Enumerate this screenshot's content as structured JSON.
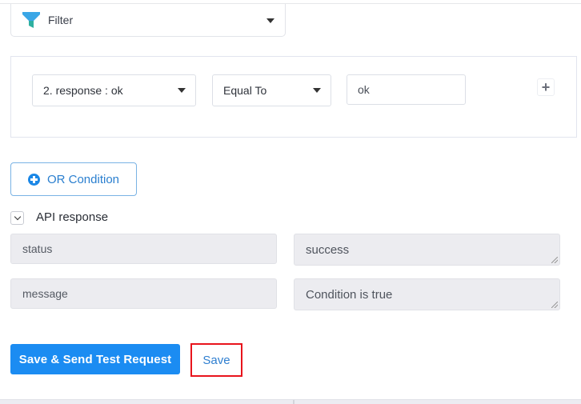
{
  "filter": {
    "label": "Filter",
    "icon": "filter-funnel-icon"
  },
  "condition": {
    "field_value": "2. response : ok",
    "operator_value": "Equal To",
    "compare_value": "ok",
    "add_label": "+"
  },
  "or_condition": {
    "label": "OR Condition",
    "icon": "plus-circle-icon"
  },
  "api_response": {
    "title": "API response",
    "toggle_icon": "chevron-down-icon",
    "rows": [
      {
        "key": "status",
        "value": "success"
      },
      {
        "key": "message",
        "value": "Condition is true"
      }
    ]
  },
  "actions": {
    "save_send_label": "Save & Send Test Request",
    "save_label": "Save"
  },
  "colors": {
    "primary": "#1b8cf2",
    "highlight": "#e8141c",
    "filter_icon_top": "#3aa6e6",
    "filter_icon_stem": "#2fb0a0"
  }
}
